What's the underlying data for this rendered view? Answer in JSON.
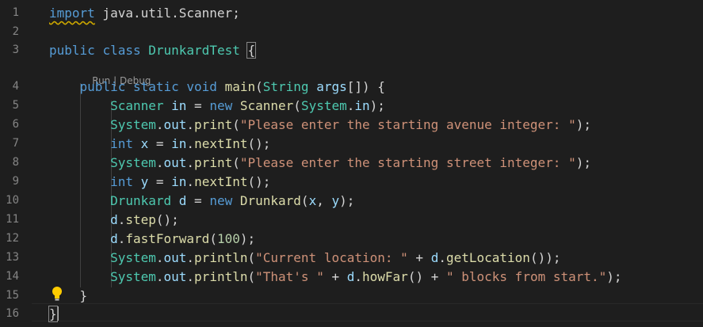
{
  "line_numbers": [
    "1",
    "2",
    "3",
    "4",
    "5",
    "6",
    "7",
    "8",
    "9",
    "10",
    "11",
    "12",
    "13",
    "14",
    "15",
    "16"
  ],
  "codelens": {
    "run": "Run",
    "separator": " | ",
    "debug": "Debug"
  },
  "code": {
    "l1": [
      [
        "kw",
        "import"
      ],
      [
        "pl",
        " java.util.Scanner;"
      ]
    ],
    "l3": [
      [
        "kw",
        "public"
      ],
      [
        "pl",
        " "
      ],
      [
        "kw",
        "class"
      ],
      [
        "pl",
        " "
      ],
      [
        "ty",
        "DrunkardTest"
      ],
      [
        "pl",
        " "
      ],
      [
        "pl",
        "{"
      ]
    ],
    "l4": [
      [
        "pl",
        "    "
      ],
      [
        "kw",
        "public"
      ],
      [
        "pl",
        " "
      ],
      [
        "kw",
        "static"
      ],
      [
        "pl",
        " "
      ],
      [
        "kw",
        "void"
      ],
      [
        "pl",
        " "
      ],
      [
        "fn",
        "main"
      ],
      [
        "pl",
        "("
      ],
      [
        "ty",
        "String"
      ],
      [
        "pl",
        " "
      ],
      [
        "vr",
        "args"
      ],
      [
        "pl",
        "[]) {"
      ]
    ],
    "l5": [
      [
        "pl",
        "        "
      ],
      [
        "ty",
        "Scanner"
      ],
      [
        "pl",
        " "
      ],
      [
        "vr",
        "in"
      ],
      [
        "pl",
        " = "
      ],
      [
        "kw",
        "new"
      ],
      [
        "pl",
        " "
      ],
      [
        "fn",
        "Scanner"
      ],
      [
        "pl",
        "("
      ],
      [
        "ty",
        "System"
      ],
      [
        "pl",
        "."
      ],
      [
        "vr",
        "in"
      ],
      [
        "pl",
        ");"
      ]
    ],
    "l6": [
      [
        "pl",
        "        "
      ],
      [
        "ty",
        "System"
      ],
      [
        "pl",
        "."
      ],
      [
        "vr",
        "out"
      ],
      [
        "pl",
        "."
      ],
      [
        "fn",
        "print"
      ],
      [
        "pl",
        "("
      ],
      [
        "st",
        "\"Please enter the starting avenue integer: \""
      ],
      [
        "pl",
        ");"
      ]
    ],
    "l7": [
      [
        "pl",
        "        "
      ],
      [
        "kw",
        "int"
      ],
      [
        "pl",
        " "
      ],
      [
        "vr",
        "x"
      ],
      [
        "pl",
        " = "
      ],
      [
        "vr",
        "in"
      ],
      [
        "pl",
        "."
      ],
      [
        "fn",
        "nextInt"
      ],
      [
        "pl",
        "();"
      ]
    ],
    "l8": [
      [
        "pl",
        "        "
      ],
      [
        "ty",
        "System"
      ],
      [
        "pl",
        "."
      ],
      [
        "vr",
        "out"
      ],
      [
        "pl",
        "."
      ],
      [
        "fn",
        "print"
      ],
      [
        "pl",
        "("
      ],
      [
        "st",
        "\"Please enter the starting street integer: \""
      ],
      [
        "pl",
        ");"
      ]
    ],
    "l9": [
      [
        "pl",
        "        "
      ],
      [
        "kw",
        "int"
      ],
      [
        "pl",
        " "
      ],
      [
        "vr",
        "y"
      ],
      [
        "pl",
        " = "
      ],
      [
        "vr",
        "in"
      ],
      [
        "pl",
        "."
      ],
      [
        "fn",
        "nextInt"
      ],
      [
        "pl",
        "();"
      ]
    ],
    "l10": [
      [
        "pl",
        "        "
      ],
      [
        "ty",
        "Drunkard"
      ],
      [
        "pl",
        " "
      ],
      [
        "vr",
        "d"
      ],
      [
        "pl",
        " = "
      ],
      [
        "kw",
        "new"
      ],
      [
        "pl",
        " "
      ],
      [
        "fn",
        "Drunkard"
      ],
      [
        "pl",
        "("
      ],
      [
        "vr",
        "x"
      ],
      [
        "pl",
        ", "
      ],
      [
        "vr",
        "y"
      ],
      [
        "pl",
        ");"
      ]
    ],
    "l11": [
      [
        "pl",
        "        "
      ],
      [
        "vr",
        "d"
      ],
      [
        "pl",
        "."
      ],
      [
        "fn",
        "step"
      ],
      [
        "pl",
        "();"
      ]
    ],
    "l12": [
      [
        "pl",
        "        "
      ],
      [
        "vr",
        "d"
      ],
      [
        "pl",
        "."
      ],
      [
        "fn",
        "fastForward"
      ],
      [
        "pl",
        "("
      ],
      [
        "nm",
        "100"
      ],
      [
        "pl",
        ");"
      ]
    ],
    "l13": [
      [
        "pl",
        "        "
      ],
      [
        "ty",
        "System"
      ],
      [
        "pl",
        "."
      ],
      [
        "vr",
        "out"
      ],
      [
        "pl",
        "."
      ],
      [
        "fn",
        "println"
      ],
      [
        "pl",
        "("
      ],
      [
        "st",
        "\"Current location: \""
      ],
      [
        "pl",
        " + "
      ],
      [
        "vr",
        "d"
      ],
      [
        "pl",
        "."
      ],
      [
        "fn",
        "getLocation"
      ],
      [
        "pl",
        "());"
      ]
    ],
    "l14": [
      [
        "pl",
        "        "
      ],
      [
        "ty",
        "System"
      ],
      [
        "pl",
        "."
      ],
      [
        "vr",
        "out"
      ],
      [
        "pl",
        "."
      ],
      [
        "fn",
        "println"
      ],
      [
        "pl",
        "("
      ],
      [
        "st",
        "\"That's \""
      ],
      [
        "pl",
        " + "
      ],
      [
        "vr",
        "d"
      ],
      [
        "pl",
        "."
      ],
      [
        "fn",
        "howFar"
      ],
      [
        "pl",
        "() + "
      ],
      [
        "st",
        "\" blocks from start.\""
      ],
      [
        "pl",
        ");"
      ]
    ],
    "l15": [
      [
        "pl",
        "    }"
      ]
    ],
    "l16": [
      [
        "pl",
        "}"
      ]
    ]
  },
  "colors": {
    "background": "#1e1e1e",
    "keyword": "#569cd6",
    "type": "#4ec9b0",
    "function": "#dcdcaa",
    "string": "#ce9178",
    "number": "#b5cea8",
    "variable": "#9cdcfe"
  }
}
